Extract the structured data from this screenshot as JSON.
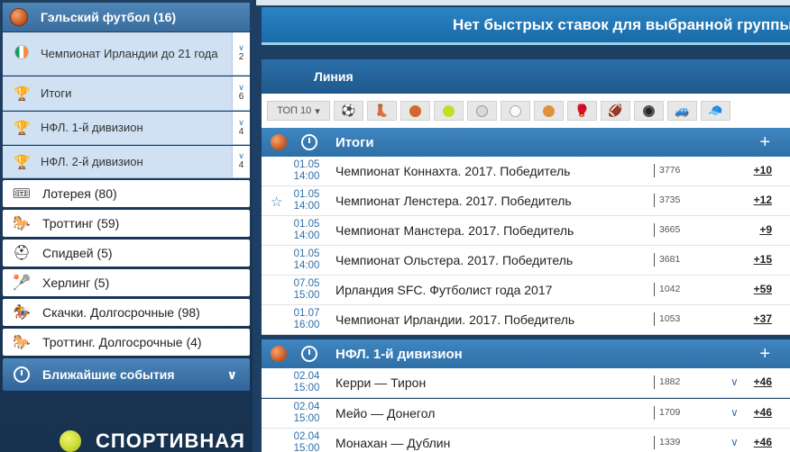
{
  "sidebar": {
    "header": "Гэльский футбол (16)",
    "subitems": [
      {
        "label": "Чемпионат Ирландии до 21 года",
        "count": "2"
      },
      {
        "label": "Итоги",
        "count": "6"
      },
      {
        "label": "НФЛ. 1-й дивизион",
        "count": "4"
      },
      {
        "label": "НФЛ. 2-й дивизион",
        "count": "4"
      }
    ],
    "sports": [
      {
        "label": "Лотерея (80)"
      },
      {
        "label": "Троттинг (59)"
      },
      {
        "label": "Спидвей (5)"
      },
      {
        "label": "Херлинг (5)"
      },
      {
        "label": "Скачки. Долгосрочные (98)"
      },
      {
        "label": "Троттинг. Долгосрочные (4)"
      }
    ],
    "nearest": "Ближайшие события",
    "logo_text": "СПОРТИВНАЯ"
  },
  "main": {
    "quick_bets_message": "Нет быстрых ставок для выбранной группы со",
    "line_title": "Линия",
    "top10_label": "ТОП 10",
    "groups": [
      {
        "title": "Итоги",
        "rows": [
          {
            "date": "01.05",
            "time": "14:00",
            "event": "Чемпионат Коннахта. 2017. Победитель",
            "id": "3776",
            "more": "+10",
            "star": false
          },
          {
            "date": "01.05",
            "time": "14:00",
            "event": "Чемпионат Ленстера. 2017. Победитель",
            "id": "3735",
            "more": "+12",
            "star": true
          },
          {
            "date": "01.05",
            "time": "14:00",
            "event": "Чемпионат Манстера. 2017. Победитель",
            "id": "3665",
            "more": "+9",
            "star": false
          },
          {
            "date": "01.05",
            "time": "14:00",
            "event": "Чемпионат Ольстера. 2017. Победитель",
            "id": "3681",
            "more": "+15",
            "star": false
          },
          {
            "date": "07.05",
            "time": "15:00",
            "event": "Ирландия SFC. Футболист года 2017",
            "id": "1042",
            "more": "+59",
            "star": false
          },
          {
            "date": "01.07",
            "time": "16:00",
            "event": "Чемпионат Ирландии. 2017. Победитель",
            "id": "1053",
            "more": "+37",
            "star": false
          }
        ]
      },
      {
        "title": "НФЛ. 1-й дивизион",
        "rows": [
          {
            "date": "02.04",
            "time": "15:00",
            "event": "Керри — Тирон",
            "id": "1882",
            "more": "+46",
            "star": false
          },
          {
            "date": "02.04",
            "time": "15:00",
            "event": "Мейо — Донегол",
            "id": "1709",
            "more": "+46",
            "star": false
          },
          {
            "date": "02.04",
            "time": "15:00",
            "event": "Монахан — Дублин",
            "id": "1339",
            "more": "+46",
            "star": false
          }
        ]
      }
    ]
  },
  "colors": {
    "accent": "#2f6fa6",
    "header_blue": "#3a6d9d",
    "sub_bg": "#cfe1f2"
  }
}
